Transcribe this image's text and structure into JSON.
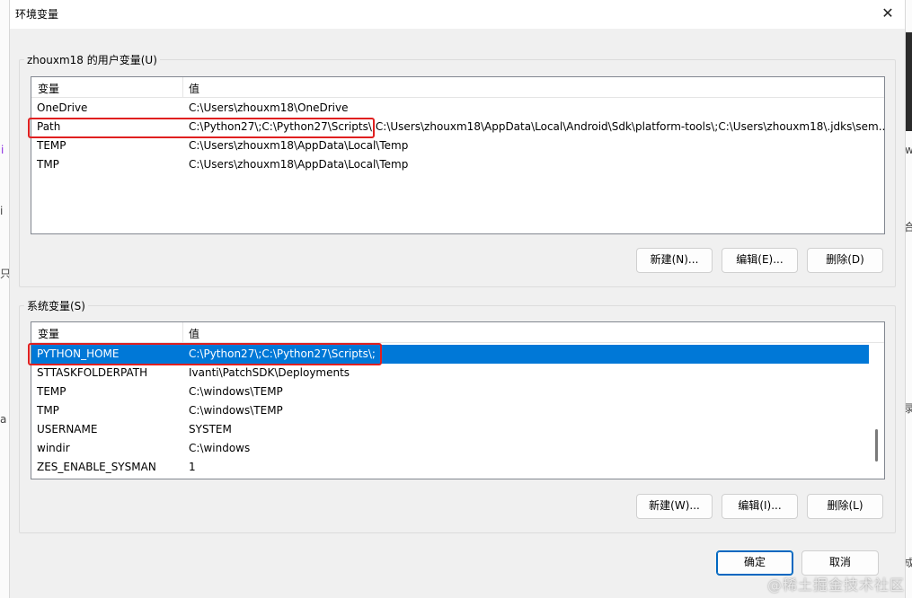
{
  "window": {
    "title": "环境变量",
    "close_glyph": "✕"
  },
  "user_vars": {
    "group_label": "zhouxm18 的用户变量(U)",
    "col_name": "变量",
    "col_value": "值",
    "rows": [
      {
        "name": "OneDrive",
        "value": "C:\\Users\\zhouxm18\\OneDrive"
      },
      {
        "name": "Path",
        "value": "C:\\Python27\\;C:\\Python27\\Scripts\\;C:\\Users\\zhouxm18\\AppData\\Local\\Android\\Sdk\\platform-tools\\;C:\\Users\\zhouxm18\\.jdks\\sem..."
      },
      {
        "name": "TEMP",
        "value": "C:\\Users\\zhouxm18\\AppData\\Local\\Temp"
      },
      {
        "name": "TMP",
        "value": "C:\\Users\\zhouxm18\\AppData\\Local\\Temp"
      }
    ],
    "buttons": {
      "new": "新建(N)...",
      "edit": "编辑(E)...",
      "delete": "删除(D)"
    }
  },
  "system_vars": {
    "group_label": "系统变量(S)",
    "col_name": "变量",
    "col_value": "值",
    "rows": [
      {
        "name": "PYTHON_HOME",
        "value": "C:\\Python27\\;C:\\Python27\\Scripts\\;"
      },
      {
        "name": "STTASKFOLDERPATH",
        "value": "Ivanti\\PatchSDK\\Deployments"
      },
      {
        "name": "TEMP",
        "value": "C:\\windows\\TEMP"
      },
      {
        "name": "TMP",
        "value": "C:\\windows\\TEMP"
      },
      {
        "name": "USERNAME",
        "value": "SYSTEM"
      },
      {
        "name": "windir",
        "value": "C:\\windows"
      },
      {
        "name": "ZES_ENABLE_SYSMAN",
        "value": "1"
      }
    ],
    "selected_row": "PYTHON_HOME",
    "buttons": {
      "new": "新建(W)...",
      "edit": "编辑(I)...",
      "delete": "删除(L)"
    }
  },
  "footer": {
    "ok": "确定",
    "cancel": "取消"
  },
  "watermark": "@稀土掘金技术社区",
  "colors": {
    "selection": "#0078d7",
    "annotation": "#e02020",
    "primary_border": "#0067c0"
  }
}
